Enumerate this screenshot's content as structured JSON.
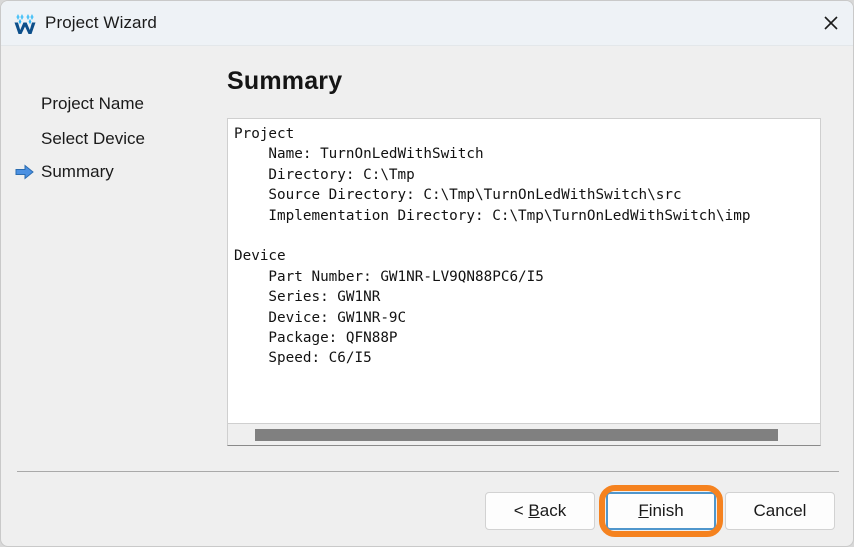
{
  "window": {
    "title": "Project Wizard",
    "logo_icon": "gowin-w-logo-icon",
    "close_icon": "close-icon"
  },
  "steps": {
    "items": [
      {
        "label": "Project Name",
        "active": false
      },
      {
        "label": "Select Device",
        "active": false
      },
      {
        "label": "Summary",
        "active": true
      }
    ],
    "active_marker_icon": "blue-right-arrow-icon"
  },
  "main": {
    "page_title": "Summary",
    "summary_text": "Project\n    Name: TurnOnLedWithSwitch\n    Directory: C:\\Tmp\n    Source Directory: C:\\Tmp\\TurnOnLedWithSwitch\\src\n    Implementation Directory: C:\\Tmp\\TurnOnLedWithSwitch\\imp\n\nDevice\n    Part Number: GW1NR-LV9QN88PC6/I5\n    Series: GW1NR\n    Device: GW1NR-9C\n    Package: QFN88P\n    Speed: C6/I5",
    "summary_fields": {
      "project": {
        "heading": "Project",
        "name": "TurnOnLedWithSwitch",
        "directory": "C:\\Tmp",
        "source_directory": "C:\\Tmp\\TurnOnLedWithSwitch\\src",
        "implementation_directory": "C:\\Tmp\\TurnOnLedWithSwitch\\imp"
      },
      "device": {
        "heading": "Device",
        "part_number": "GW1NR-LV9QN88PC6/I5",
        "series": "GW1NR",
        "device": "GW1NR-9C",
        "package": "QFN88P",
        "speed": "C6/I5"
      }
    }
  },
  "footer": {
    "back_label": "< Back",
    "back_accel": "B",
    "finish_label": "Finish",
    "finish_accel": "F",
    "cancel_label": "Cancel"
  },
  "colors": {
    "highlight_orange": "#f5821f",
    "focus_blue": "#4f96cc",
    "titlebar": "#eef2f6",
    "dialog_bg": "#efefef",
    "scroll_thumb": "#808080"
  }
}
